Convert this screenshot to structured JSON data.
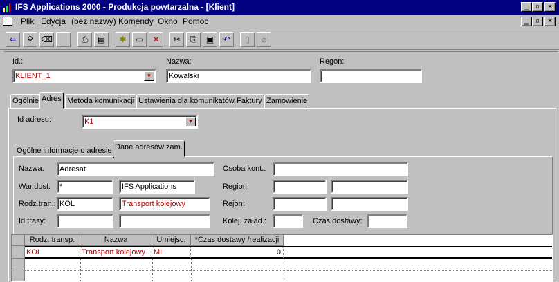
{
  "window": {
    "title": "IFS Applications 2000 - Produkcja powtarzalna - [Klient]"
  },
  "menu": [
    "Plik",
    "Edycja",
    "(bez nazwy)",
    "Komendy",
    "Okno",
    "Pomoc"
  ],
  "toolbar": {
    "icons": [
      "back-arrow-icon",
      "binoculars-icon",
      "eraser-icon",
      "blank-icon",
      "print-icon",
      "print-preview-icon",
      "new-icon",
      "open-window-icon",
      "delete-icon",
      "cut-icon",
      "copy-icon",
      "paste-icon",
      "undo-icon",
      "document-icon",
      "attachment-icon"
    ]
  },
  "header": {
    "id_label": "Id.:",
    "id_value": "KLIENT_1",
    "name_label": "Nazwa:",
    "name_value": "Kowalski",
    "region_label": "Regon:",
    "region_value": ""
  },
  "tabs": [
    "Ogólnie",
    "Adres",
    "Metoda komunikacji",
    "Ustawienia dla komunikatów",
    "Faktury",
    "Zamówienie"
  ],
  "address": {
    "id_label": "Id adresu:",
    "id_value": "K1"
  },
  "subtabs": [
    "Ogólne informacje o adresie",
    "Dane adresów zam."
  ],
  "form": {
    "nazwa_label": "Nazwa:",
    "nazwa_value": "Adresat",
    "osoba_label": "Osoba kont.:",
    "osoba_value": "",
    "war_label": "War.dost:",
    "war_code": "*",
    "war_desc": "IFS Applications",
    "region_label": "Region:",
    "region_a": "",
    "region_b": "",
    "rodz_label": "Rodz.tran.:",
    "rodz_code": "KOL",
    "rodz_desc": "Transport kolejowy",
    "rejon_label": "Rejon:",
    "rejon_a": "",
    "rejon_b": "",
    "trasa_label": "Id trasy:",
    "trasa_a": "",
    "trasa_b": "",
    "kolej_label": "Kolej. załad.:",
    "kolej_value": "",
    "czas_label": "Czas dostawy:",
    "czas_value": ""
  },
  "table": {
    "headers": [
      "Rodz. transp.",
      "Nazwa",
      "Umiejsc.",
      "*Czas dostawy /realizacji"
    ],
    "rows": [
      [
        "KOL",
        "Transport kolejowy",
        "MI",
        "0"
      ]
    ]
  }
}
